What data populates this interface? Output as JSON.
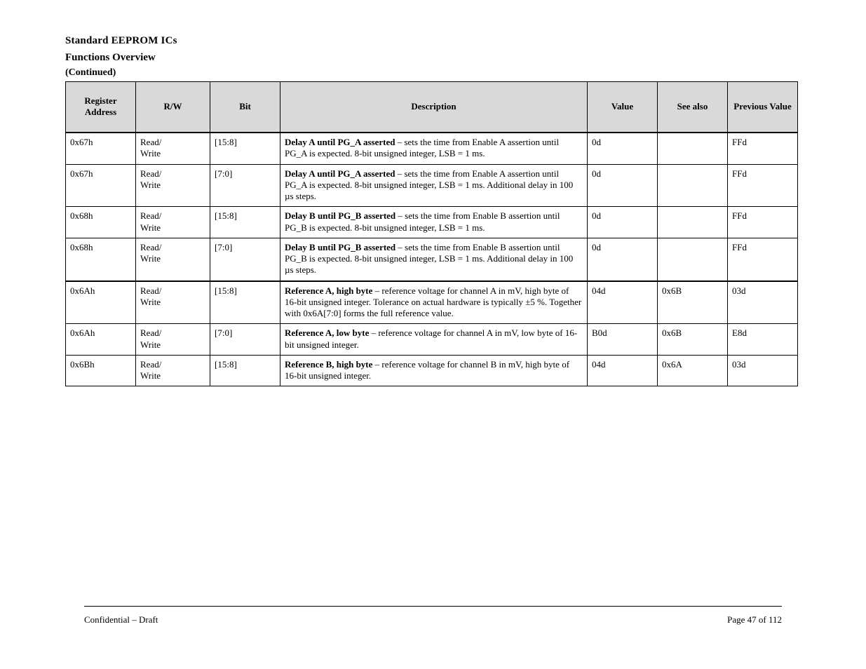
{
  "header": {
    "doc_title": "Standard  EEPROM  ICs",
    "section_title": "Functions  Overview",
    "continued": "(Continued)"
  },
  "table": {
    "columns": {
      "addr": "Register\nAddress",
      "access": "R/W",
      "bit": "Bit",
      "desc": "Description",
      "value": "Value",
      "also": "See\nalso",
      "prev": "Previous\nValue"
    },
    "rows": [
      {
        "addr": "0x67h",
        "access": "Read/\nWrite",
        "bit": "[15:8]",
        "desc_bold": "Delay A until PG_A asserted ",
        "desc_rest": "– sets the time from Enable A assertion until PG_A is expected. 8-bit unsigned integer, LSB = 1 ms.",
        "value": "0d",
        "also": "",
        "prev": "FFd"
      },
      {
        "addr": "0x67h",
        "access": "Read/\nWrite",
        "bit": "[7:0]",
        "desc_bold": "Delay A until PG_A asserted ",
        "desc_rest": "– sets the time from Enable A assertion until PG_A is expected. 8-bit unsigned integer, LSB = 1 ms. Additional delay in 100 µs steps.",
        "value": "0d",
        "also": "",
        "prev": "FFd"
      },
      {
        "addr": "0x68h",
        "access": "Read/\nWrite",
        "bit": "[15:8]",
        "desc_bold": "Delay B until PG_B asserted ",
        "desc_rest": "– sets the time from Enable B assertion until PG_B is expected. 8-bit unsigned integer, LSB = 1 ms.",
        "value": "0d",
        "also": "",
        "prev": "FFd"
      },
      {
        "addr": "0x68h",
        "access": "Read/\nWrite",
        "bit": "[7:0]",
        "desc_bold": "Delay B until PG_B asserted ",
        "desc_rest": "– sets the time from Enable B assertion until PG_B is expected. 8-bit unsigned integer, LSB = 1 ms. Additional delay in 100 µs steps.",
        "value": "0d",
        "also": "",
        "prev": "FFd",
        "section_end": true
      },
      {
        "addr": "0x6Ah",
        "access": "Read/\nWrite",
        "bit": "[15:8]",
        "desc_bold": "Reference A, high byte ",
        "desc_rest": "– reference voltage for channel A in mV, high byte of 16-bit unsigned integer. Tolerance on actual hardware is typically ±5 %. Together with 0x6A[7:0] forms the full reference value.",
        "value": "04d",
        "also": "0x6B",
        "prev": "03d"
      },
      {
        "addr": "0x6Ah",
        "access": "Read/\nWrite",
        "bit": "[7:0]",
        "desc_bold": "Reference A, low byte ",
        "desc_rest": "– reference voltage for channel A in mV, low byte of 16-bit unsigned integer.",
        "value": "B0d",
        "also": "0x6B",
        "prev": "E8d"
      },
      {
        "addr": "0x6Bh",
        "access": "Read/\nWrite",
        "bit": "[15:8]",
        "desc_bold": "Reference B, high byte ",
        "desc_rest": "– reference voltage for channel B in mV, high byte of 16-bit unsigned integer.",
        "value": "04d",
        "also": "0x6A",
        "prev": "03d"
      }
    ]
  },
  "footer": {
    "left": "Confidential – Draft",
    "right": "Page 47 of 112"
  }
}
